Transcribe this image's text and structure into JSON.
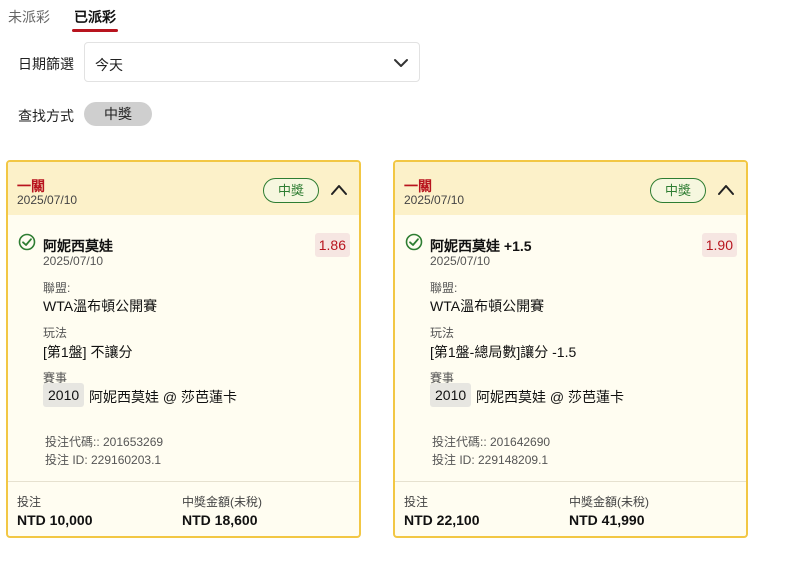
{
  "tabs": [
    {
      "label": "未派彩",
      "active": false
    },
    {
      "label": "已派彩",
      "active": true
    }
  ],
  "filter": {
    "date_label": "日期篩選",
    "date_value": "今天",
    "search_label": "查找方式",
    "search_value": "中獎"
  },
  "cards": [
    {
      "type": "一關",
      "date": "2025/07/10",
      "status": "中獎",
      "selection": "阿妮西莫娃",
      "selection_date": "2025/07/10",
      "odds": "1.86",
      "league_label": "聯盟:",
      "league": "WTA溫布頓公開賽",
      "market_label": "玩法",
      "market": "[第1盤] 不讓分",
      "event_label": "賽事",
      "event_id": "2010",
      "event_name": "阿妮西莫娃 @ 莎芭蓮卡",
      "bet_code": "投注代碼:: 201653269",
      "bet_id": "投注 ID: 229160203.1",
      "stake_label": "投注",
      "stake": "NTD 10,000",
      "payout_label": "中獎金額(未稅)",
      "payout": "NTD 18,600"
    },
    {
      "type": "一關",
      "date": "2025/07/10",
      "status": "中獎",
      "selection": "阿妮西莫娃 +1.5",
      "selection_date": "2025/07/10",
      "odds": "1.90",
      "league_label": "聯盟:",
      "league": "WTA溫布頓公開賽",
      "market_label": "玩法",
      "market": "[第1盤-總局數]讓分 -1.5",
      "event_label": "賽事",
      "event_id": "2010",
      "event_name": "阿妮西莫娃 @ 莎芭蓮卡",
      "bet_code": "投注代碼:: 201642690",
      "bet_id": "投注 ID: 229148209.1",
      "stake_label": "投注",
      "stake": "NTD 22,100",
      "payout_label": "中獎金額(未稅)",
      "payout": "NTD 41,990"
    }
  ],
  "colors": {
    "accent": "#b8141e",
    "win": "#2e7d32",
    "card_border": "#f2c744",
    "card_header": "#fcf1c9"
  },
  "icons": [
    "chevron-down-icon",
    "chevron-up-icon",
    "check-circle-icon"
  ]
}
